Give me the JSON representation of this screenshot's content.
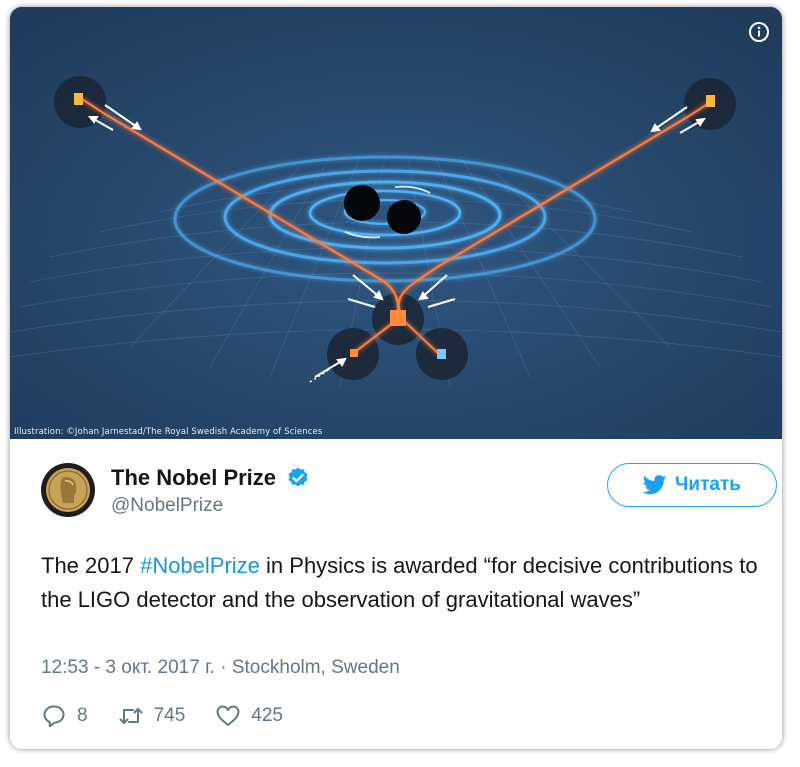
{
  "media": {
    "credit": "Illustration: ©Johan Jarnestad/The Royal Swedish Academy of Sciences",
    "info_icon": "info-icon"
  },
  "author": {
    "display_name": "The Nobel Prize",
    "handle": "@NobelPrize",
    "verified": true,
    "avatar_icon": "nobel-medal-avatar"
  },
  "follow_button": {
    "label": "Читать",
    "icon": "twitter-bird-icon"
  },
  "tweet": {
    "text_before": "The 2017 ",
    "hashtag": "#NobelPrize",
    "text_after": " in Physics is awarded “for decisive contributions to the LIGO detector and the observation of gravitational waves”"
  },
  "meta": {
    "time": "12:53 - 3 окт. 2017 г.",
    "separator": " · ",
    "location": "Stockholm, Sweden"
  },
  "actions": {
    "replies": "8",
    "retweets": "745",
    "likes": "425"
  },
  "colors": {
    "accent": "#1da1f2",
    "hashtag": "#1b95e0",
    "text": "#14171a",
    "secondary": "#657786",
    "media_bg": "#2a4a6c"
  }
}
